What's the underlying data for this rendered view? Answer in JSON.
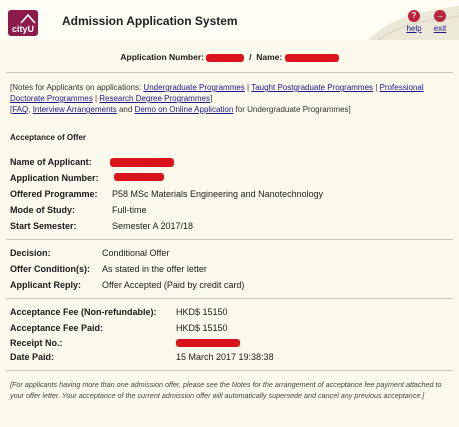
{
  "header": {
    "logo_text": "cityU",
    "title": "Admission Application System",
    "help_label": "help",
    "help_symbol": "?",
    "exit_label": "exit",
    "exit_symbol": "→"
  },
  "application": {
    "number_label": "Application Number:",
    "separator": "/",
    "name_label": "Name:"
  },
  "notes": {
    "line1_prefix": "[Notes for Applicants on applications:",
    "links": [
      "Undergraduate Programmes",
      "Taught Postgraduate Programmes",
      "Professional Doctorate Programmes",
      "Research Degree Programmes"
    ],
    "sep": "|",
    "line1_suffix": "]",
    "faq_link": "FAQ",
    "interview_link": "Interview Arrangements",
    "and_text": "and",
    "demo_link": "Demo on Online Application",
    "line2_suffix": "for Undergraduate Programmes]"
  },
  "section": {
    "title": "Acceptance of Offer"
  },
  "applicant": {
    "name_label": "Name of Applicant:",
    "number_label": "Application Number:",
    "programme_label": "Offered Programme:",
    "programme_value": "P58 MSc Materials Engineering and Nanotechnology",
    "mode_label": "Mode of Study:",
    "mode_value": "Full-time",
    "semester_label": "Start Semester:",
    "semester_value": "Semester A 2017/18"
  },
  "decision": {
    "decision_label": "Decision:",
    "decision_value": "Conditional Offer",
    "conditions_label": "Offer Condition(s):",
    "conditions_value": "As stated in the offer letter",
    "reply_label": "Applicant Reply:",
    "reply_value": "Offer Accepted (Paid by credit card)"
  },
  "payment": {
    "fee_label": "Acceptance Fee (Non-refundable):",
    "fee_value": "HKD$ 15150",
    "paid_label": "Acceptance Fee Paid:",
    "paid_value": "HKD$ 15150",
    "receipt_label": "Receipt No.:",
    "date_label": "Date Paid:",
    "date_value": "15 March 2017 19:38:38"
  },
  "footnote": "[For applicants having more than one admission offer, please see the Notes for the arrangement of acceptance fee payment attached to your offer letter. Your acceptance of the current admission offer will automatically supersede and cancel any previous acceptance.]",
  "colors": {
    "redaction": "#d9141a",
    "link": "#1a1a8e",
    "brand": "#8c1a4a",
    "background": "#fbf8ec"
  }
}
